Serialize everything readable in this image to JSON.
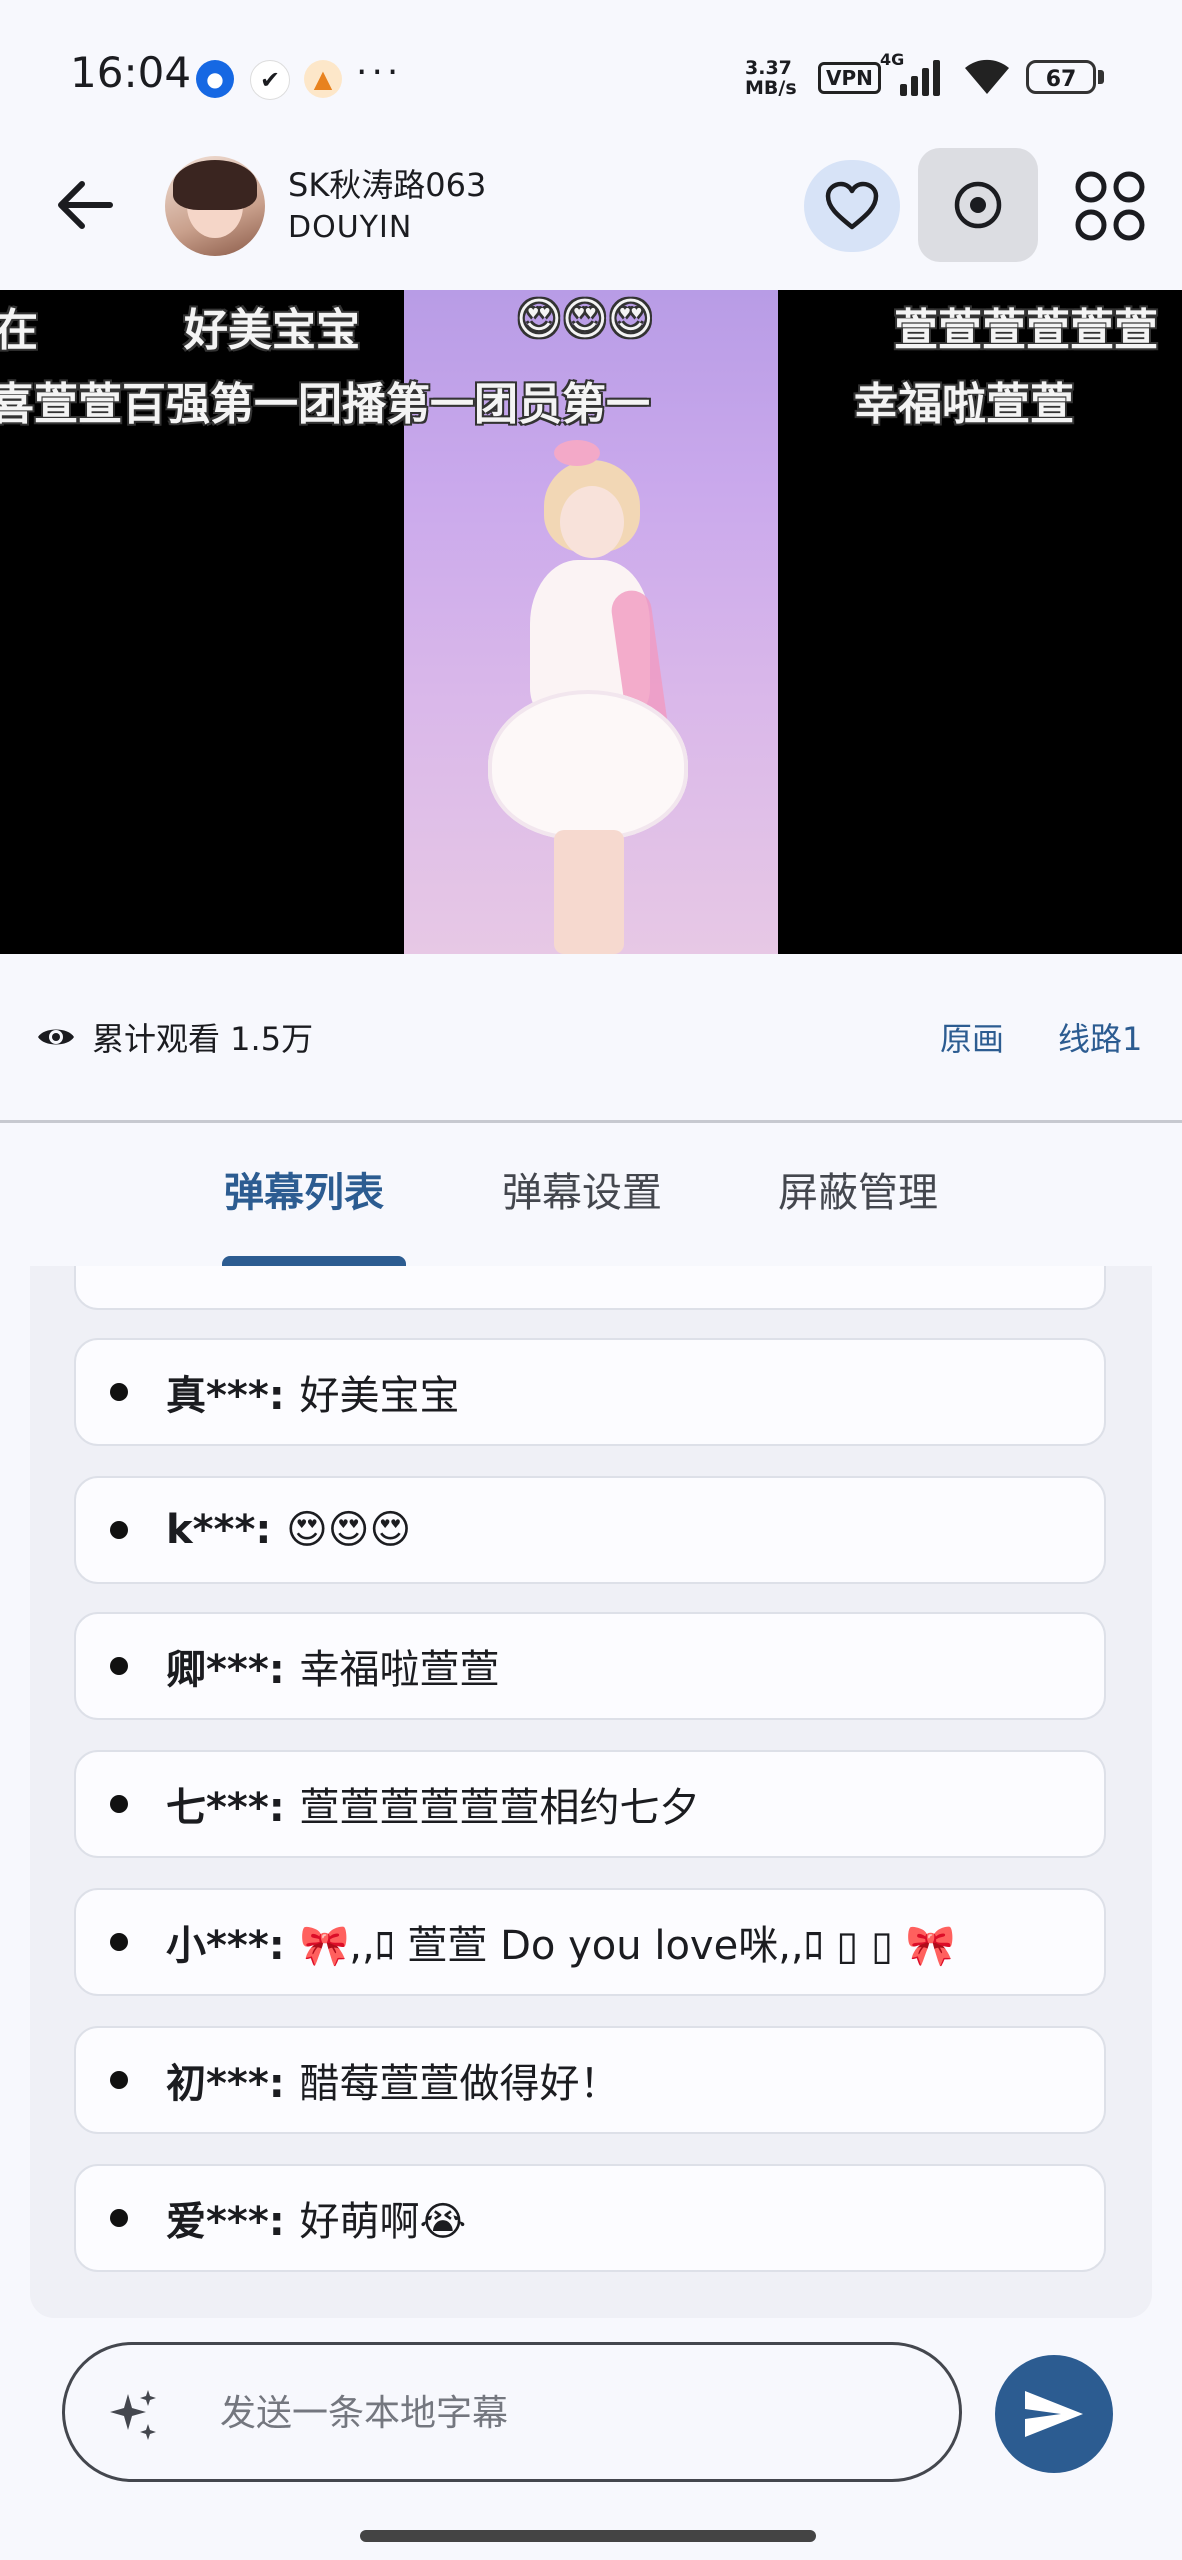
{
  "status_bar": {
    "time": "16:04",
    "more": "···",
    "speed_value": "3.37",
    "speed_unit": "MB/s",
    "vpn": "VPN",
    "network": "4G",
    "battery": "67"
  },
  "header": {
    "streamer_name": "SK秋涛路063",
    "platform": "DOUYIN"
  },
  "video": {
    "danmaku": [
      "在",
      "好美宝宝",
      "😍😍😍",
      "萱萱萱萱萱萱",
      "喜萱萱百强第一团播第一团员第一",
      "幸福啦萱萱"
    ]
  },
  "info": {
    "views_label": "累计观看 1.5万",
    "quality": "原画",
    "line": "线路1"
  },
  "tabs": [
    "弹幕列表",
    "弹幕设置",
    "屏蔽管理"
  ],
  "danmaku_list": [
    {
      "user": "真***:",
      "text": "好美宝宝"
    },
    {
      "user": "k***:",
      "text": "😍😍😍"
    },
    {
      "user": "卿***:",
      "text": "幸福啦萱萱"
    },
    {
      "user": "七***:",
      "text": "萱萱萱萱萱萱相约七夕"
    },
    {
      "user": "小***:",
      "text": "🎀,,ﾛ 萱萱 Do you love咪,,ﾛ ▯ ▯ 🎀"
    },
    {
      "user": "初***:",
      "text": "醋莓萱萱做得好！"
    },
    {
      "user": "爱***:",
      "text": "好萌啊😭"
    }
  ],
  "input": {
    "placeholder": "发送一条本地字幕"
  },
  "colors": {
    "accent": "#2c5c91",
    "background": "#f7f8fd",
    "follow_bg": "#d7e3f7"
  }
}
